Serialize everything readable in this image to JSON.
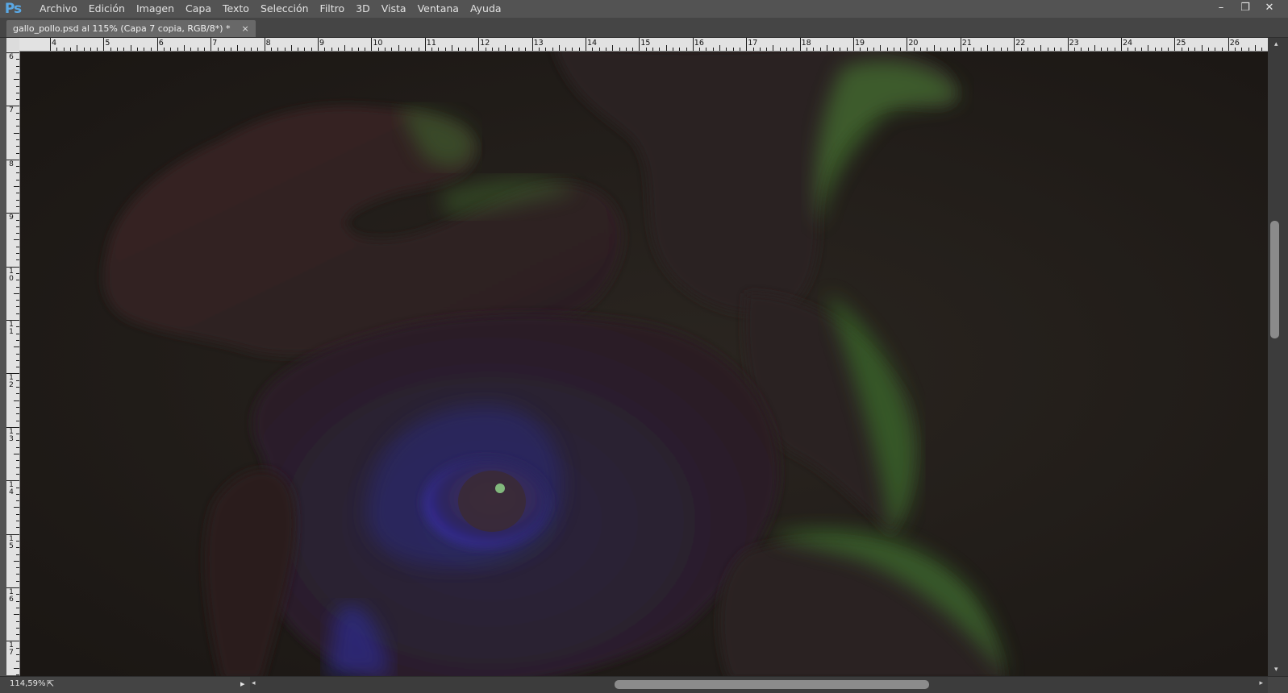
{
  "app": {
    "logo_text": "Ps"
  },
  "menu": {
    "items": [
      "Archivo",
      "Edición",
      "Imagen",
      "Capa",
      "Texto",
      "Selección",
      "Filtro",
      "3D",
      "Vista",
      "Ventana",
      "Ayuda"
    ]
  },
  "window_controls": {
    "minimize": "–",
    "restore": "❐",
    "close": "✕"
  },
  "document_tab": {
    "title": "gallo_pollo.psd al 115% (Capa 7 copia, RGB/8*) *",
    "close": "×"
  },
  "ruler_top": {
    "labels": [
      "4",
      "5",
      "6",
      "7",
      "8",
      "9",
      "10",
      "11",
      "12",
      "13",
      "14",
      "15",
      "16",
      "17",
      "18",
      "19",
      "20",
      "21",
      "22",
      "23",
      "24",
      "25",
      "26"
    ]
  },
  "ruler_left": {
    "labels": [
      "6",
      "7",
      "8",
      "9",
      "10",
      "11",
      "12",
      "13",
      "14",
      "15",
      "16",
      "17"
    ]
  },
  "canvas": {
    "image_icon": "rooster-artwork-image"
  },
  "status": {
    "zoom": "114,59%",
    "share_icon": "share-icon",
    "arrow": "▸"
  },
  "scrollbars": {
    "up": "▴",
    "down": "▾",
    "left": "◂",
    "right": "▸"
  },
  "colors": {
    "ui_bg": "#535353",
    "tab_bg": "#686868",
    "canvas_bg": "#1e1a17",
    "accent_ps": "#5aa9e6"
  }
}
